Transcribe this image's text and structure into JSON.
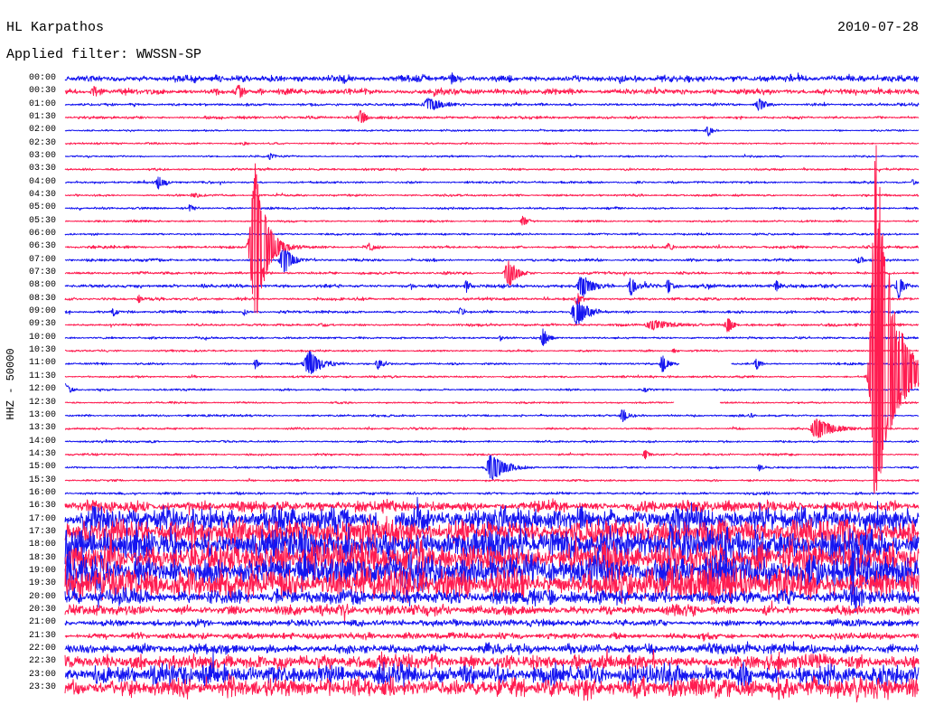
{
  "chart_data": {
    "type": "line",
    "title": "HL Karpathos",
    "date": "2010-07-28",
    "filter": "Applied filter: WWSSN-SP",
    "ylabel": "HHZ - 50000",
    "xlim": [
      0,
      30
    ],
    "grid": false,
    "colors": {
      "blue": "#1515f0",
      "red": "#ff1c50"
    },
    "series": [
      {
        "label": "00:00",
        "color": "#1515f0",
        "noise": 12000,
        "events": [
          {
            "t": 9.8,
            "dur": 0.5,
            "amp": 20000
          },
          {
            "t": 13.6,
            "dur": 0.5,
            "amp": 18000
          },
          {
            "t": 19.5,
            "dur": 0.6,
            "amp": 14000
          }
        ]
      },
      {
        "label": "00:30",
        "color": "#ff1c50",
        "noise": 10000,
        "events": [
          {
            "t": 1.0,
            "dur": 0.6,
            "amp": 18000
          },
          {
            "t": 6.1,
            "dur": 0.6,
            "amp": 24000
          },
          {
            "t": 13.0,
            "dur": 0.5,
            "amp": 14000
          }
        ]
      },
      {
        "label": "01:00",
        "color": "#1515f0",
        "noise": 5000,
        "events": [
          {
            "t": 12.8,
            "dur": 1.3,
            "amp": 28000
          },
          {
            "t": 24.4,
            "dur": 0.6,
            "amp": 24000
          }
        ]
      },
      {
        "label": "01:30",
        "color": "#ff1c50",
        "noise": 5000,
        "events": [
          {
            "t": 10.4,
            "dur": 0.5,
            "amp": 35000
          }
        ]
      },
      {
        "label": "02:00",
        "color": "#1515f0",
        "noise": 3500,
        "events": [
          {
            "t": 22.6,
            "dur": 0.4,
            "amp": 24000
          }
        ]
      },
      {
        "label": "02:30",
        "color": "#ff1c50",
        "noise": 3500,
        "events": [
          {
            "t": 6.3,
            "dur": 0.3,
            "amp": 8000
          }
        ]
      },
      {
        "label": "03:00",
        "color": "#1515f0",
        "noise": 3500,
        "events": [
          {
            "t": 7.2,
            "dur": 0.4,
            "amp": 14000
          }
        ]
      },
      {
        "label": "03:30",
        "color": "#ff1c50",
        "noise": 4000,
        "events": []
      },
      {
        "label": "04:00",
        "color": "#1515f0",
        "noise": 4000,
        "events": [
          {
            "t": 3.3,
            "dur": 0.6,
            "amp": 24000
          },
          {
            "t": 29.8,
            "dur": 0.3,
            "amp": 14000
          }
        ]
      },
      {
        "label": "04:30",
        "color": "#ff1c50",
        "noise": 4000,
        "events": [
          {
            "t": 4.6,
            "dur": 1.0,
            "amp": 8000
          }
        ]
      },
      {
        "label": "05:00",
        "color": "#1515f0",
        "noise": 4000,
        "events": [
          {
            "t": 4.4,
            "dur": 0.4,
            "amp": 14000
          }
        ]
      },
      {
        "label": "05:30",
        "color": "#ff1c50",
        "noise": 4000,
        "events": [
          {
            "t": 16.1,
            "dur": 0.5,
            "amp": 20000
          }
        ]
      },
      {
        "label": "06:00",
        "color": "#1515f0",
        "noise": 4000,
        "events": []
      },
      {
        "label": "06:30",
        "color": "#ff1c50",
        "noise": 5000,
        "events": [
          {
            "t": 6.7,
            "dur": 1.0,
            "peak_pos": 350000,
            "peak_neg": 330000
          },
          {
            "t": 10.7,
            "dur": 0.5,
            "amp": 14000
          },
          {
            "t": 21.2,
            "dur": 0.6,
            "amp": 12000
          }
        ]
      },
      {
        "label": "07:00",
        "color": "#1515f0",
        "noise": 5000,
        "events": [
          {
            "t": 7.7,
            "dur": 0.8,
            "amp": 55000
          },
          {
            "t": 27.9,
            "dur": 0.4,
            "amp": 14000
          }
        ]
      },
      {
        "label": "07:30",
        "color": "#ff1c50",
        "noise": 5000,
        "events": [
          {
            "t": 15.6,
            "dur": 0.8,
            "amp": 55000
          }
        ]
      },
      {
        "label": "08:00",
        "color": "#1515f0",
        "noise": 7000,
        "events": [
          {
            "t": 14.1,
            "dur": 0.4,
            "amp": 24000
          },
          {
            "t": 18.2,
            "dur": 1.0,
            "amp": 45000
          },
          {
            "t": 19.9,
            "dur": 0.5,
            "amp": 40000
          },
          {
            "t": 21.2,
            "dur": 0.4,
            "amp": 28000
          },
          {
            "t": 25.0,
            "dur": 0.4,
            "amp": 20000
          },
          {
            "t": 29.3,
            "dur": 0.5,
            "amp": 45000
          }
        ]
      },
      {
        "label": "08:30",
        "color": "#ff1c50",
        "noise": 5000,
        "events": [
          {
            "t": 2.6,
            "dur": 0.4,
            "amp": 14000
          },
          {
            "t": 18.0,
            "dur": 0.5,
            "amp": 24000
          }
        ]
      },
      {
        "label": "09:00",
        "color": "#1515f0",
        "noise": 5000,
        "events": [
          {
            "t": 1.7,
            "dur": 0.4,
            "amp": 18000
          },
          {
            "t": 6.3,
            "dur": 0.3,
            "amp": 14000
          },
          {
            "t": 13.9,
            "dur": 0.4,
            "amp": 18000
          },
          {
            "t": 18.0,
            "dur": 1.0,
            "amp": 55000
          }
        ]
      },
      {
        "label": "09:30",
        "color": "#ff1c50",
        "noise": 5000,
        "events": [
          {
            "t": 20.6,
            "dur": 2.5,
            "amp": 18000
          },
          {
            "t": 23.3,
            "dur": 0.5,
            "amp": 30000
          }
        ]
      },
      {
        "label": "10:00",
        "color": "#1515f0",
        "noise": 4000,
        "events": [
          {
            "t": 15.3,
            "dur": 0.3,
            "amp": 12000
          },
          {
            "t": 16.8,
            "dur": 0.5,
            "amp": 35000
          }
        ]
      },
      {
        "label": "10:30",
        "color": "#ff1c50",
        "noise": 3500,
        "events": [
          {
            "t": 21.4,
            "dur": 0.3,
            "amp": 10000
          }
        ]
      },
      {
        "label": "11:00",
        "color": "#1515f0",
        "noise": 4000,
        "events": [
          {
            "t": 6.7,
            "dur": 0.3,
            "amp": 24000
          },
          {
            "t": 8.6,
            "dur": 1.0,
            "amp": 50000
          },
          {
            "t": 11.0,
            "dur": 0.5,
            "amp": 20000
          },
          {
            "t": 21.0,
            "dur": 0.5,
            "amp": 35000
          },
          {
            "t": 24.3,
            "dur": 0.4,
            "amp": 24000
          }
        ],
        "gaps": [
          [
            21.6,
            23.4
          ]
        ]
      },
      {
        "label": "11:30",
        "color": "#ff1c50",
        "noise": 4000,
        "events": [
          {
            "t": 28.5,
            "dur": 1.7,
            "peak_pos": 940000,
            "peak_neg": 520000
          }
        ]
      },
      {
        "label": "12:00",
        "color": "#1515f0",
        "noise": 4000,
        "events": [
          {
            "t": 0.0,
            "dur": 0.5,
            "amp": 25000
          },
          {
            "t": 20.4,
            "dur": 0.5,
            "amp": 10000
          }
        ]
      },
      {
        "label": "12:30",
        "color": "#ff1c50",
        "noise": 3500,
        "events": [],
        "gaps": [
          [
            21.4,
            23.0
          ]
        ]
      },
      {
        "label": "13:00",
        "color": "#1515f0",
        "noise": 4000,
        "events": [
          {
            "t": 19.6,
            "dur": 0.5,
            "amp": 25000
          },
          {
            "t": 24.1,
            "dur": 0.3,
            "amp": 12000
          }
        ]
      },
      {
        "label": "13:30",
        "color": "#ff1c50",
        "noise": 4000,
        "events": [
          {
            "t": 26.4,
            "dur": 1.8,
            "amp": 40000
          }
        ]
      },
      {
        "label": "14:00",
        "color": "#1515f0",
        "noise": 4000,
        "events": []
      },
      {
        "label": "14:30",
        "color": "#ff1c50",
        "noise": 4000,
        "events": [
          {
            "t": 20.4,
            "dur": 0.4,
            "amp": 18000
          }
        ]
      },
      {
        "label": "15:00",
        "color": "#1515f0",
        "noise": 4000,
        "events": [
          {
            "t": 15.0,
            "dur": 1.4,
            "amp": 55000
          },
          {
            "t": 24.4,
            "dur": 0.3,
            "amp": 14000
          }
        ]
      },
      {
        "label": "15:30",
        "color": "#ff1c50",
        "noise": 3500,
        "events": []
      },
      {
        "label": "16:00",
        "color": "#1515f0",
        "noise": 5000,
        "events": []
      },
      {
        "label": "16:30",
        "color": "#ff1c50",
        "noise": 21000,
        "events": []
      },
      {
        "label": "17:00",
        "color": "#1515f0",
        "noise": 50000,
        "events": [],
        "gaps": [
          [
            11.0,
            11.6
          ]
        ]
      },
      {
        "label": "17:30",
        "color": "#ff1c50",
        "noise": 50000,
        "events": []
      },
      {
        "label": "18:00",
        "color": "#1515f0",
        "noise": 63000,
        "events": []
      },
      {
        "label": "18:30",
        "color": "#ff1c50",
        "noise": 63000,
        "events": []
      },
      {
        "label": "19:00",
        "color": "#1515f0",
        "noise": 63000,
        "events": [
          {
            "t": 27.7,
            "dur": 0.6,
            "amp": 110000
          }
        ]
      },
      {
        "label": "19:30",
        "color": "#ff1c50",
        "noise": 56000,
        "events": []
      },
      {
        "label": "20:00",
        "color": "#1515f0",
        "noise": 28000,
        "events": [
          {
            "t": 27.7,
            "dur": 0.5,
            "amp": 55000
          }
        ]
      },
      {
        "label": "20:30",
        "color": "#ff1c50",
        "noise": 17500,
        "events": []
      },
      {
        "label": "21:00",
        "color": "#1515f0",
        "noise": 12000,
        "events": []
      },
      {
        "label": "21:30",
        "color": "#ff1c50",
        "noise": 12000,
        "events": []
      },
      {
        "label": "22:00",
        "color": "#1515f0",
        "noise": 17500,
        "events": []
      },
      {
        "label": "22:30",
        "color": "#ff1c50",
        "noise": 28000,
        "events": []
      },
      {
        "label": "23:00",
        "color": "#1515f0",
        "noise": 38000,
        "events": []
      },
      {
        "label": "23:30",
        "color": "#ff1c50",
        "noise": 38000,
        "events": []
      }
    ]
  }
}
